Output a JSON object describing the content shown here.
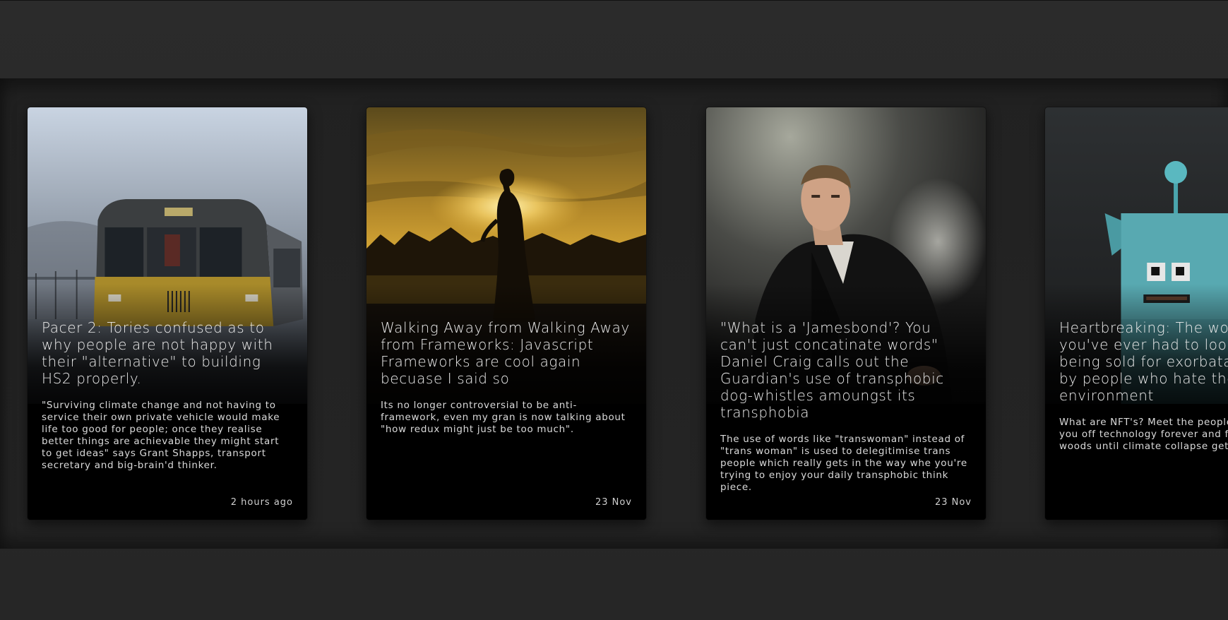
{
  "cards": [
    {
      "title": "Pacer 2: Tories confused as to why people are not happy with their \"alternative\" to building HS2 properly.",
      "description": "\"Surviving climate change and not having to service their own private vehicle would make life too good for people; once they realise better things are achievable they might start to get ideas\" says Grant Shapps, transport secretary and big-brain'd thinker.",
      "date": "2 hours ago",
      "image": "train-in-fog"
    },
    {
      "title": "Walking Away from Walking Away from Frameworks: Javascript Frameworks are cool again becuase I said so",
      "description": "Its no longer controversial to be anti-framework, even my gran is now talking about \"how redux might just be too much\".",
      "date": "23 Nov",
      "image": "woman-silhouette-sunset"
    },
    {
      "title": "\"What is a 'Jamesbond'? You can't just concatinate words\" Daniel Craig calls out the Guardian's use of transphobic dog-whistles amoungst its transphobia",
      "description": "The use of words like \"transwoman\" instead of \"trans woman\" is used to delegitimise trans people which really gets in the way whe you're trying to enjoy your daily transphobic think piece.",
      "date": "23 Nov",
      "image": "man-in-suit-portrait"
    },
    {
      "title": "Heartbreaking: The worst thing you've ever had to look at is being sold for exorbatant prices by people who hate the environment",
      "description": "What are NFT's? Meet the people trying to put you off technology forever and flee to the woods until climate collapse gets you too.",
      "date": "",
      "image": "pixel-robot-nft"
    }
  ],
  "colors": {
    "background": "#272727",
    "card": "#000000",
    "text": "#e8e8e8"
  }
}
